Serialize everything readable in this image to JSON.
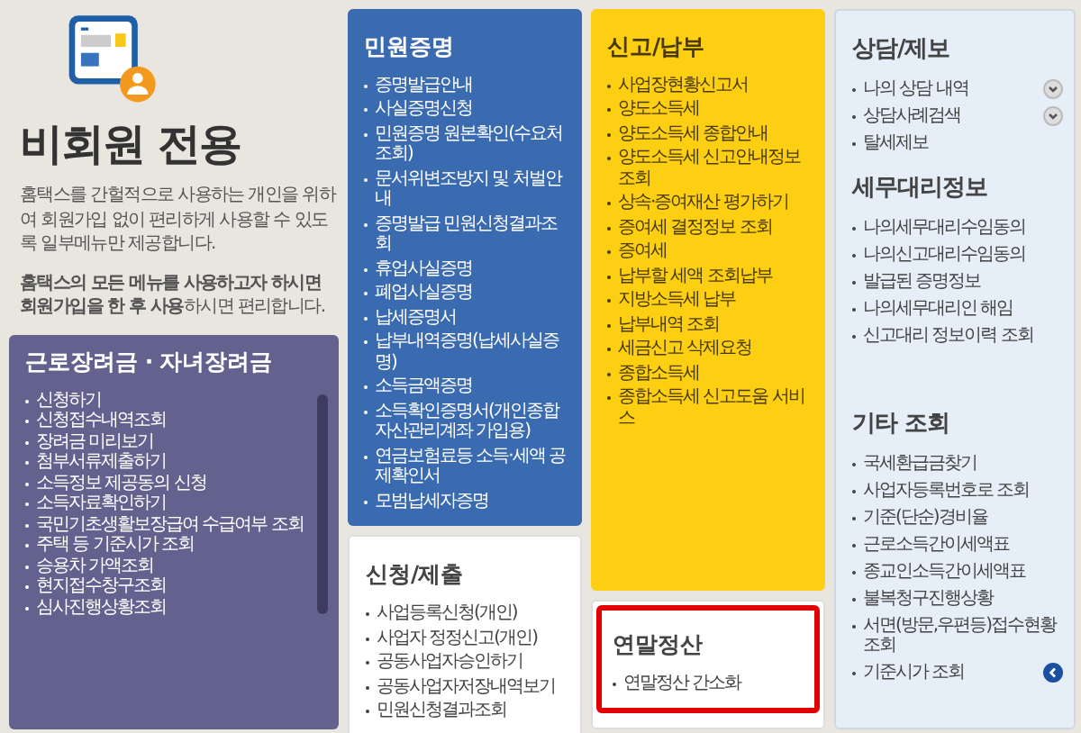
{
  "intro": {
    "title": "비회원 전용",
    "description": "홈택스를 간헐적으로 사용하는 개인을 위하여 회원가입 없이 편리하게 사용할 수 있도록 일부메뉴만 제공합니다.",
    "note": "**홈택스의 모든 메뉴를 사용하고자 하시면 회원가입을 한 후 사용**하시면 편리합니다."
  },
  "incentive_panel": {
    "title": "근로장려금 · 자녀장려금",
    "items": [
      "신청하기",
      "신청접수내역조회",
      "장려금 미리보기",
      "첨부서류제출하기",
      "소득정보 제공동의 신청",
      "소득자료확인하기",
      "국민기초생활보장급여 수급여부 조회",
      "주택 등 기준시가 조회",
      "승용차 가액조회",
      "현지접수창구조회",
      "심사진행상황조회"
    ]
  },
  "certificates_panel": {
    "title": "민원증명",
    "items": [
      "증명발급안내",
      "사실증명신청",
      "민원증명 원본확인(수요처 조회)",
      "문서위변조방지 및 처벌안내",
      "증명발급 민원신청결과조회",
      "휴업사실증명",
      "폐업사실증명",
      "납세증명서",
      "납부내역증명(납세사실증명)",
      "소득금액증명",
      "소득확인증명서(개인종합자산관리계좌 가입용)",
      "연금보험료등 소득·세액 공제확인서",
      "모범납세자증명"
    ]
  },
  "filing_panel": {
    "title": "신고/납부",
    "items": [
      "사업장현황신고서",
      "양도소득세",
      "양도소득세 종합안내",
      "양도소득세 신고안내정보조회",
      "상속·증여재산 평가하기",
      "증여세 결정정보 조회",
      "증여세",
      "납부할 세액 조회납부",
      "지방소득세 납부",
      "납부내역 조회",
      "세금신고 삭제요청",
      "종합소득세",
      "종합소득세 신고도움 서비스"
    ]
  },
  "application_panel": {
    "title": "신청/제출",
    "items": [
      "사업등록신청(개인)",
      "사업자 정정신고(개인)",
      "공동사업자승인하기",
      "공동사업자저장내역보기",
      "민원신청결과조회"
    ]
  },
  "year_end_panel": {
    "title": "연말정산",
    "highlighted": true,
    "items": [
      "연말정산 간소화"
    ]
  },
  "side_panel": {
    "sections": [
      {
        "title": "상담/제보",
        "items": [
          {
            "label": "나의 상담 내역",
            "kind": "dropdown"
          },
          {
            "label": "상담사례검색",
            "kind": "dropdown"
          },
          {
            "label": "탈세제보",
            "kind": "plain"
          }
        ]
      },
      {
        "title": "세무대리정보",
        "items": [
          {
            "label": "나의세무대리수임동의",
            "kind": "plain"
          },
          {
            "label": "나의신고대리수임동의",
            "kind": "plain"
          },
          {
            "label": "발급된 증명정보",
            "kind": "plain"
          },
          {
            "label": "나의세무대리인 해임",
            "kind": "plain"
          },
          {
            "label": "신고대리 정보이력 조회",
            "kind": "plain"
          }
        ]
      },
      {
        "title": "기타 조회",
        "items": [
          {
            "label": "국세환급금찾기",
            "kind": "plain"
          },
          {
            "label": "사업자등록번호로 조회",
            "kind": "plain"
          },
          {
            "label": "기준(단순)경비율",
            "kind": "plain"
          },
          {
            "label": "근로소득간이세액표",
            "kind": "plain"
          },
          {
            "label": "종교인소득간이세액표",
            "kind": "plain"
          },
          {
            "label": "불복청구진행상황",
            "kind": "plain"
          },
          {
            "label": "서면(방문,우편등)접수현황조회",
            "kind": "plain"
          },
          {
            "label": "기준시가 조회",
            "kind": "pointer"
          }
        ]
      }
    ]
  }
}
